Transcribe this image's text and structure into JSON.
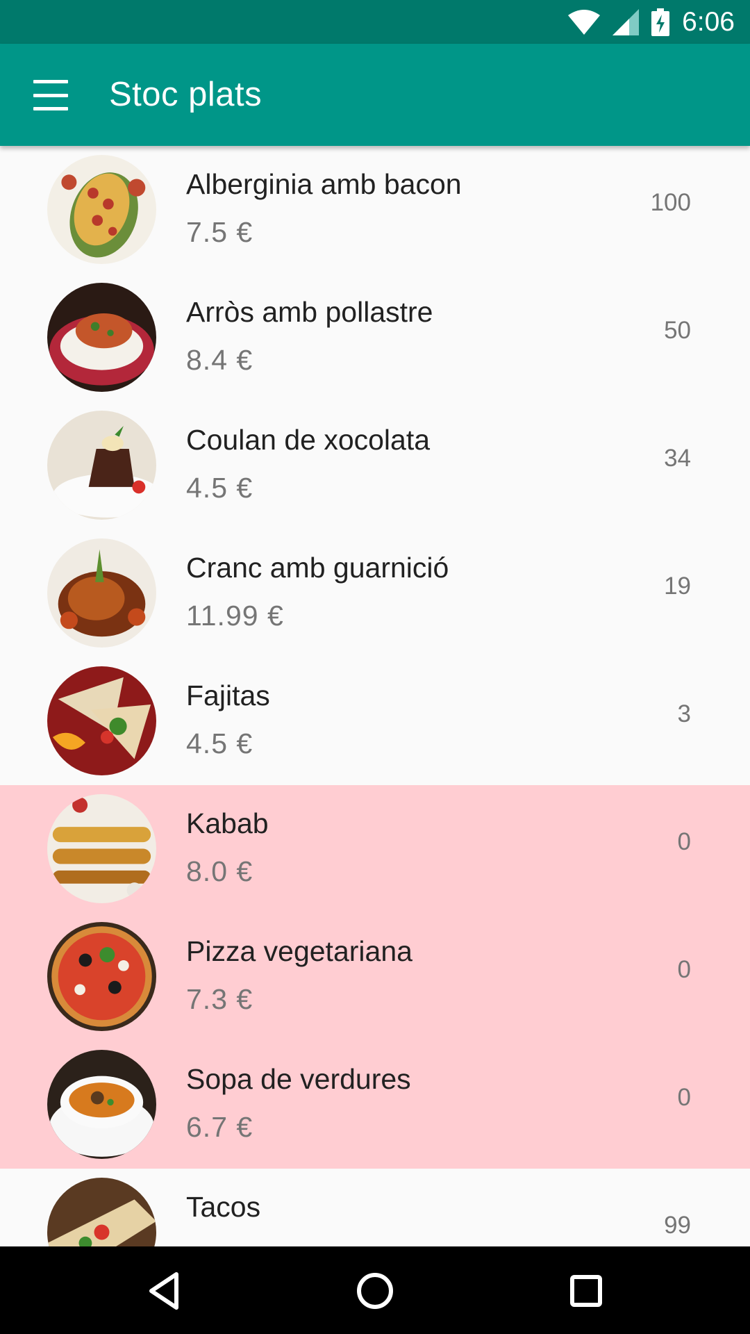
{
  "status_bar": {
    "time": "6:06",
    "icons": [
      "wifi-icon",
      "signal-icon",
      "battery-charging-icon"
    ]
  },
  "app_bar": {
    "title": "Stoc plats",
    "menu_icon": "hamburger-menu-icon"
  },
  "colors": {
    "primary": "#009688",
    "primary_dark": "#00796b",
    "out_of_stock_bg": "#ffcdd2"
  },
  "dishes": [
    {
      "name": "Alberginia amb bacon",
      "price": "7.5 €",
      "stock": "100",
      "out_of_stock": false
    },
    {
      "name": "Arròs amb pollastre",
      "price": "8.4 €",
      "stock": "50",
      "out_of_stock": false
    },
    {
      "name": "Coulan de xocolata",
      "price": "4.5 €",
      "stock": "34",
      "out_of_stock": false
    },
    {
      "name": "Cranc amb guarnició",
      "price": "11.99 €",
      "stock": "19",
      "out_of_stock": false
    },
    {
      "name": "Fajitas",
      "price": "4.5 €",
      "stock": "3",
      "out_of_stock": false
    },
    {
      "name": "Kabab",
      "price": "8.0 €",
      "stock": "0",
      "out_of_stock": true
    },
    {
      "name": "Pizza vegetariana",
      "price": "7.3 €",
      "stock": "0",
      "out_of_stock": true
    },
    {
      "name": "Sopa de verdures",
      "price": "6.7 €",
      "stock": "0",
      "out_of_stock": true
    },
    {
      "name": "Tacos",
      "price": "",
      "stock": "99",
      "out_of_stock": false
    }
  ],
  "nav_bar": {
    "icons": [
      "back-icon",
      "home-icon",
      "recents-icon"
    ]
  }
}
